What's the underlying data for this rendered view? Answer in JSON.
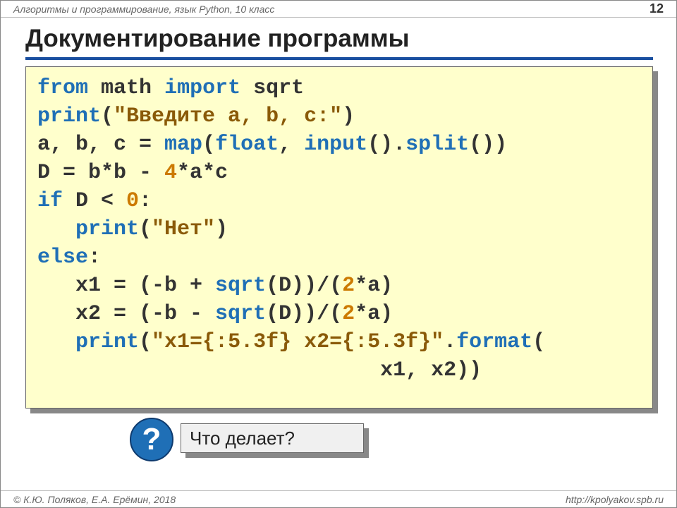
{
  "header": {
    "text": "Алгоритмы и программирование, язык Python, 10 класс",
    "page": "12"
  },
  "title": "Документирование программы",
  "code": {
    "kw_from": "from",
    "kw_import": "import",
    "kw_if": "if",
    "kw_else": "else",
    "fn_print": "print",
    "fn_map": "map",
    "fn_float": "float",
    "fn_input": "input",
    "fn_split": "split",
    "fn_sqrt": "sqrt",
    "fn_format": "format",
    "mod_math": "math",
    "id_sqrt": "sqrt",
    "str_prompt": "\"Введите a, b, c:\"",
    "str_no": "\"Нет\"",
    "str_fmt": "\"x1={:5.3f} x2={:5.3f}\"",
    "num_4": "4",
    "num_0": "0",
    "num_2a": "2",
    "num_2b": "2",
    "assign_abc": "a, b, c = ",
    "paren_open": "(",
    "paren_close": ")",
    "comma_sp": ", ",
    "empty_call": "()",
    "dot": ".",
    "assign_D": "D = b*b - ",
    "star_ac": "*a*c",
    "if_rest": " D < ",
    "colon": ":",
    "indent3": "   ",
    "x1_pre": "   x1 = (-b + ",
    "sqrt_D_close": "(D))/(",
    "star_a_close": "*a)",
    "x2_pre": "   x2 = (-b - ",
    "print_pad": "                           x1, x2))"
  },
  "question": {
    "mark": "?",
    "text": "Что делает?"
  },
  "footer": {
    "left": "© К.Ю. Поляков, Е.А. Ерёмин, 2018",
    "right": "http://kpolyakov.spb.ru"
  }
}
